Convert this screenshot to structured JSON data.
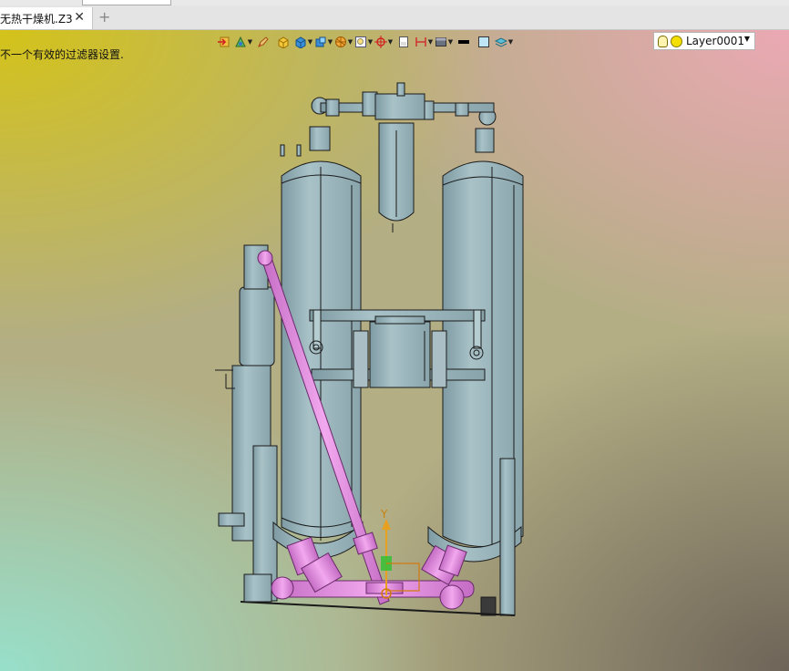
{
  "tab": {
    "title": "无热干燥机.Z3",
    "close_glyph": "✕",
    "new_glyph": "+"
  },
  "viewport": {
    "status_text": "不一个有效的过滤器设置.",
    "layer": {
      "name": "Layer0001",
      "dropdown_glyph": "▼"
    },
    "toolbar_icons": [
      "import-icon",
      "shaded-view-icon",
      "edit-pencil-icon",
      "solid-box-icon",
      "box-view-icon",
      "box-face-icon",
      "sphere-section-icon",
      "zoom-box-icon",
      "pan-target-icon",
      "sheet-icon",
      "dimension-icon",
      "display-mode-icon",
      "line-color-icon",
      "fill-color-icon",
      "layer-stack-icon"
    ],
    "triad": {
      "y_label": "Y"
    }
  },
  "colors": {
    "tank": "#97b3ba",
    "tank_edge": "#1b1b1b",
    "pipe": "#e38de0",
    "axis_y": "#e8a020",
    "axis_z": "#35c035"
  }
}
